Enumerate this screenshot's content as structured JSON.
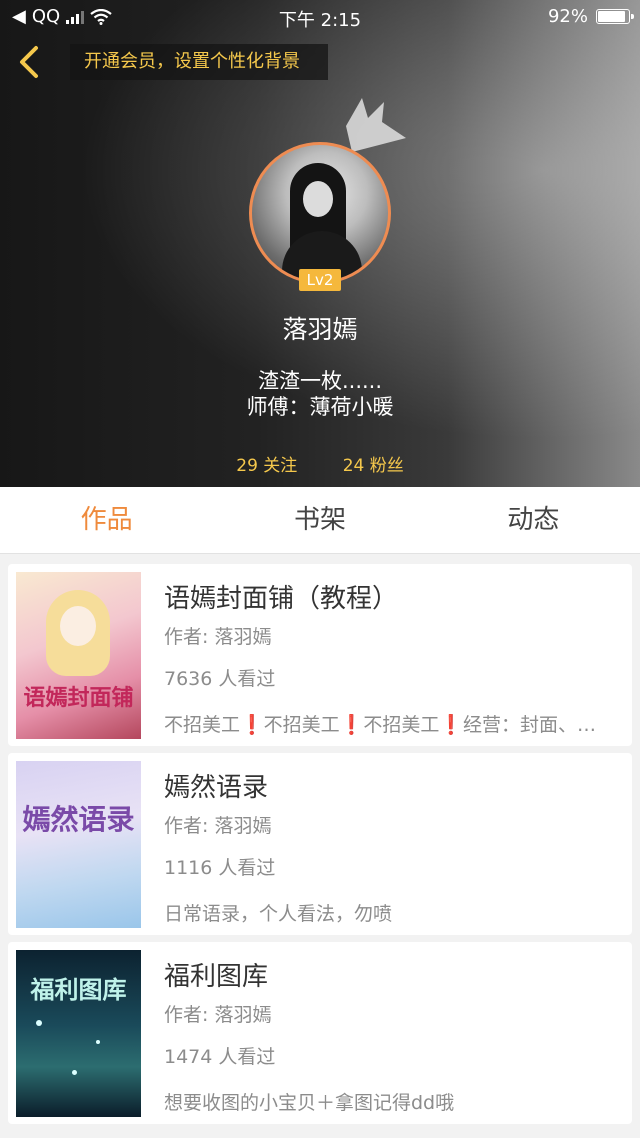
{
  "status_bar": {
    "carrier_app": "QQ",
    "time": "下午 2:15",
    "battery_percent": "92%",
    "battery_level": 0.92
  },
  "header": {
    "vip_banner": "开通会员，设置个性化背景",
    "level_badge": "Lv2",
    "nickname": "落羽嫣",
    "bio_line1": "渣渣一枚......",
    "bio_line2": "师傅：薄荷小暖",
    "following": "29 关注",
    "followers": "24 粉丝"
  },
  "tabs": [
    {
      "label": "作品",
      "active": true
    },
    {
      "label": "书架",
      "active": false
    },
    {
      "label": "动态",
      "active": false
    }
  ],
  "works": [
    {
      "title": "语嫣封面铺（教程）",
      "author": "作者: 落羽嫣",
      "views": "7636 人看过",
      "desc": "不招美工❗️不招美工❗️不招美工❗️经营：封面、名片、作者签、头像、字素",
      "cover_text": "语嫣封面铺",
      "cover_icon": "anime-girl-cover"
    },
    {
      "title": "嫣然语录",
      "author": "作者: 落羽嫣",
      "views": "1116 人看过",
      "desc": "日常语录，个人看法，勿喷",
      "cover_text": "嫣然语录",
      "cover_icon": "pastel-lettering-cover"
    },
    {
      "title": "福利图库",
      "author": "作者: 落羽嫣",
      "views": "1474 人看过",
      "desc": "想要收图的小宝贝＋拿图记得dd哦",
      "cover_text": "福利图库",
      "cover_icon": "starry-night-cover"
    }
  ],
  "colors": {
    "accent_orange": "#ef8a3c",
    "gold": "#f5c84c",
    "avatar_ring": "#ee8c52"
  }
}
